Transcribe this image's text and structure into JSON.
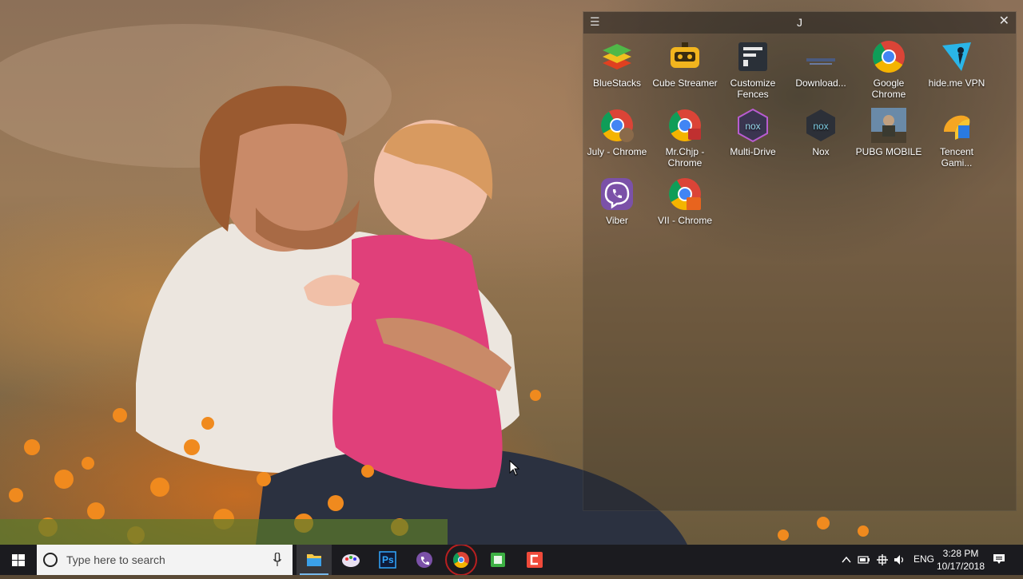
{
  "fence": {
    "title": "J",
    "menu_icon": "hamburger-icon",
    "close_icon": "close-icon",
    "items": [
      {
        "label": "BlueStacks",
        "icon": "bluestacks-icon"
      },
      {
        "label": "Cube Streamer",
        "icon": "cube-streamer-icon"
      },
      {
        "label": "Customize Fences",
        "icon": "fences-icon"
      },
      {
        "label": "Download...",
        "icon": "download-icon"
      },
      {
        "label": "Google Chrome",
        "icon": "chrome-icon"
      },
      {
        "label": "hide.me VPN",
        "icon": "hideme-vpn-icon"
      },
      {
        "label": "July - Chrome",
        "icon": "chrome-profile-icon"
      },
      {
        "label": "Mr.Chjp - Chrome",
        "icon": "chrome-profile-icon"
      },
      {
        "label": "Multi-Drive",
        "icon": "nox-multi-drive-icon"
      },
      {
        "label": "Nox",
        "icon": "nox-icon"
      },
      {
        "label": "PUBG MOBILE",
        "icon": "pubg-icon"
      },
      {
        "label": "Tencent Gami...",
        "icon": "tencent-gaming-icon"
      },
      {
        "label": "Viber",
        "icon": "viber-icon"
      },
      {
        "label": "VII - Chrome",
        "icon": "chrome-profile-mr-icon"
      }
    ]
  },
  "taskbar": {
    "search_placeholder": "Type here to search",
    "apps": [
      {
        "name": "file-explorer",
        "icon": "folder-icon"
      },
      {
        "name": "paint",
        "icon": "paint-icon"
      },
      {
        "name": "photoshop",
        "icon": "photoshop-icon",
        "text": "Ps"
      },
      {
        "name": "viber",
        "icon": "viber-icon"
      },
      {
        "name": "chrome",
        "icon": "chrome-icon"
      },
      {
        "name": "camtasia-green",
        "icon": "green-app-icon"
      },
      {
        "name": "recorder",
        "icon": "red-app-icon"
      }
    ],
    "tray": {
      "language": "ENG",
      "time": "3:28 PM",
      "date": "10/17/2018"
    }
  },
  "colors": {
    "taskbar_bg": "#1b1b1f",
    "accent": "#76b9ed"
  }
}
